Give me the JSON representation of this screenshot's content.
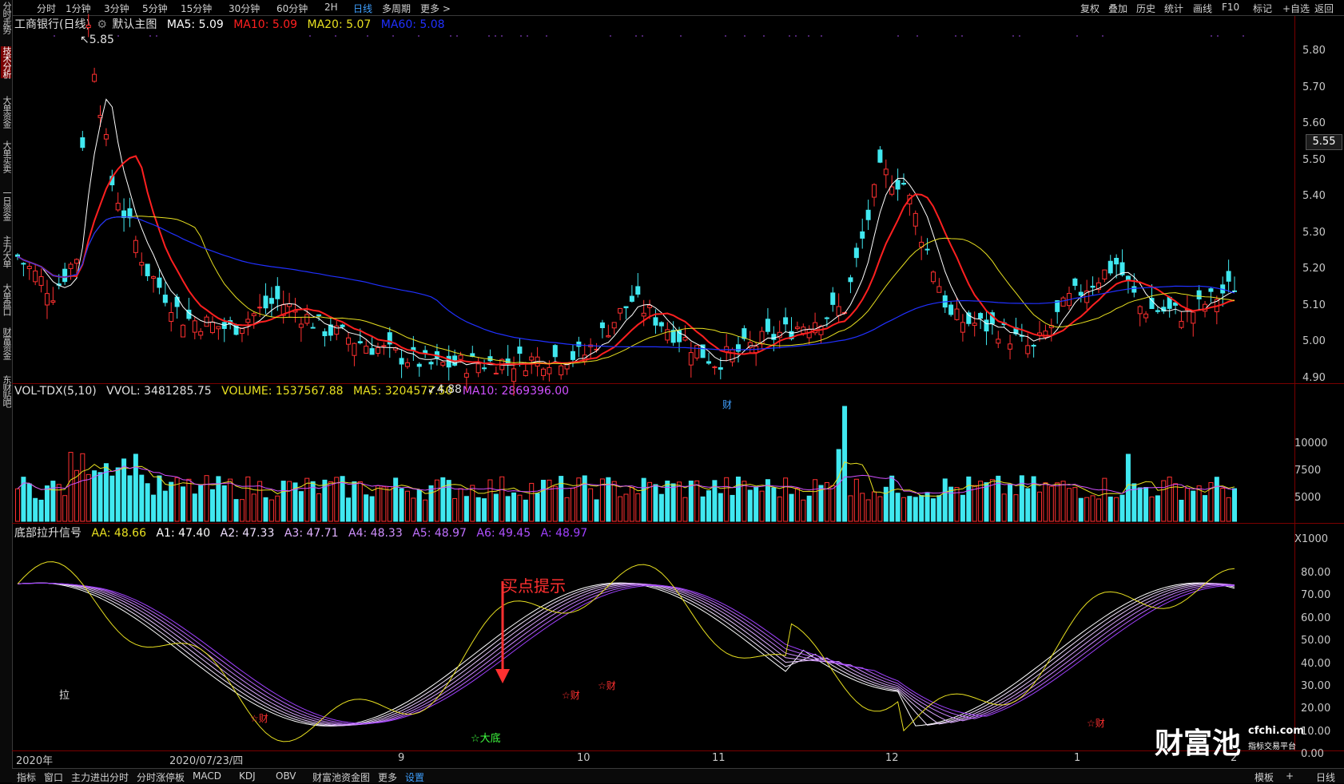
{
  "toolbar": {
    "periods": [
      "分时",
      "1分钟",
      "3分钟",
      "5分钟",
      "15分钟",
      "30分钟",
      "60分钟",
      "2H",
      "日线",
      "多周期",
      "更多"
    ],
    "active_period": "日线",
    "right_tools": [
      "复权",
      "叠加",
      "历史",
      "统计",
      "画线",
      "F10",
      "标记",
      "+自选",
      "返回"
    ]
  },
  "left_tabs": [
    {
      "label": "分时走势",
      "active": false
    },
    {
      "label": "技术分析",
      "active": true
    },
    {
      "label": "大单资金",
      "active": false
    },
    {
      "label": "大单买卖",
      "active": false
    },
    {
      "label": "一日资金",
      "active": false
    },
    {
      "label": "主力大单",
      "active": false
    },
    {
      "label": "大单盘口",
      "active": false
    },
    {
      "label": "财富资金",
      "active": false
    },
    {
      "label": "东财贴吧",
      "active": false
    }
  ],
  "main_legend": {
    "title": "工商银行(日线)",
    "template": "默认主图",
    "ma5": "MA5: 5.09",
    "ma10": "MA10: 5.09",
    "ma20": "MA20: 5.07",
    "ma60": "MA60: 5.08",
    "colors": {
      "ma5": "#ffffff",
      "ma10": "#ff2020",
      "ma20": "#e8e020",
      "ma60": "#2030ff"
    }
  },
  "price_axis": [
    "5.80",
    "5.70",
    "5.60",
    "5.50",
    "5.40",
    "5.30",
    "5.20",
    "5.10",
    "5.00",
    "4.90"
  ],
  "current_price": "5.55",
  "annotations": {
    "high": "5.85",
    "low": "4.88",
    "cai": "财"
  },
  "vol_legend": {
    "title": "VOL-TDX(5,10)",
    "vvol": "VVOL: 3481285.75",
    "volume": "VOLUME: 1537567.88",
    "ma5": "MA5: 3204577.50",
    "ma10": "MA10: 2869396.00"
  },
  "vol_axis": [
    "10000",
    "7500",
    "5000",
    "X1000"
  ],
  "ind_legend": {
    "title": "底部拉升信号",
    "aa": "AA: 48.66",
    "a1": "A1: 47.40",
    "a2": "A2: 47.33",
    "a3": "A3: 47.71",
    "a4": "A4: 48.33",
    "a5": "A5: 48.97",
    "a6": "A6: 49.45",
    "a": "A: 48.97"
  },
  "ind_axis": [
    "80.00",
    "70.00",
    "60.00",
    "50.00",
    "40.00",
    "30.00",
    "20.00",
    "10.00",
    "0.00"
  ],
  "ind_annotations": {
    "buy_hint": "买点提示",
    "la": "拉",
    "dadi": "☆大底",
    "cai": "☆财"
  },
  "x_axis": [
    "2020年",
    "2020/07/23/四",
    "9",
    "10",
    "11",
    "12",
    "1",
    "2"
  ],
  "bottom_tabs": [
    "指标",
    "窗口",
    "主力进出分时",
    "分时涨停板",
    "MACD",
    "KDJ",
    "OBV",
    "财富池资金图",
    "更多",
    "设置"
  ],
  "bottom_right": [
    "模板",
    "+",
    "日线"
  ],
  "watermark": {
    "brand": "财富池",
    "site": "cfchi.com",
    "slogan": "指标交易平台"
  }
}
